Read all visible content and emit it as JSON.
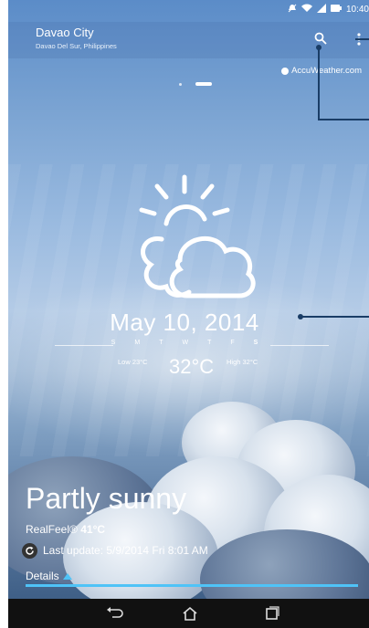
{
  "status_bar": {
    "time": "10:40"
  },
  "header": {
    "city": "Davao City",
    "region": "Davao Del Sur, Philippines"
  },
  "source": {
    "label": "AccuWeather.com"
  },
  "forecast": {
    "date": "May 10, 2014",
    "days": [
      "S",
      "M",
      "T",
      "W",
      "T",
      "F",
      "S"
    ],
    "active_day_index": 6,
    "low": "Low 23°C",
    "current_temp": "32°C",
    "high": "High 32°C"
  },
  "condition": {
    "title": "Partly sunny",
    "realfeel_label": "RealFeel®",
    "realfeel_value": "41°C",
    "last_update": "Last update: 5/9/2014 Fri  8:01 AM"
  },
  "details": {
    "label": "Details"
  },
  "icons": {
    "search": "search-icon",
    "menu": "overflow-menu-icon",
    "weather": "partly-sunny-icon",
    "refresh": "refresh-icon",
    "back": "back-icon",
    "home": "home-icon",
    "recents": "recent-apps-icon"
  },
  "colors": {
    "accent": "#4fc3f7",
    "callout": "#1a3d66"
  }
}
